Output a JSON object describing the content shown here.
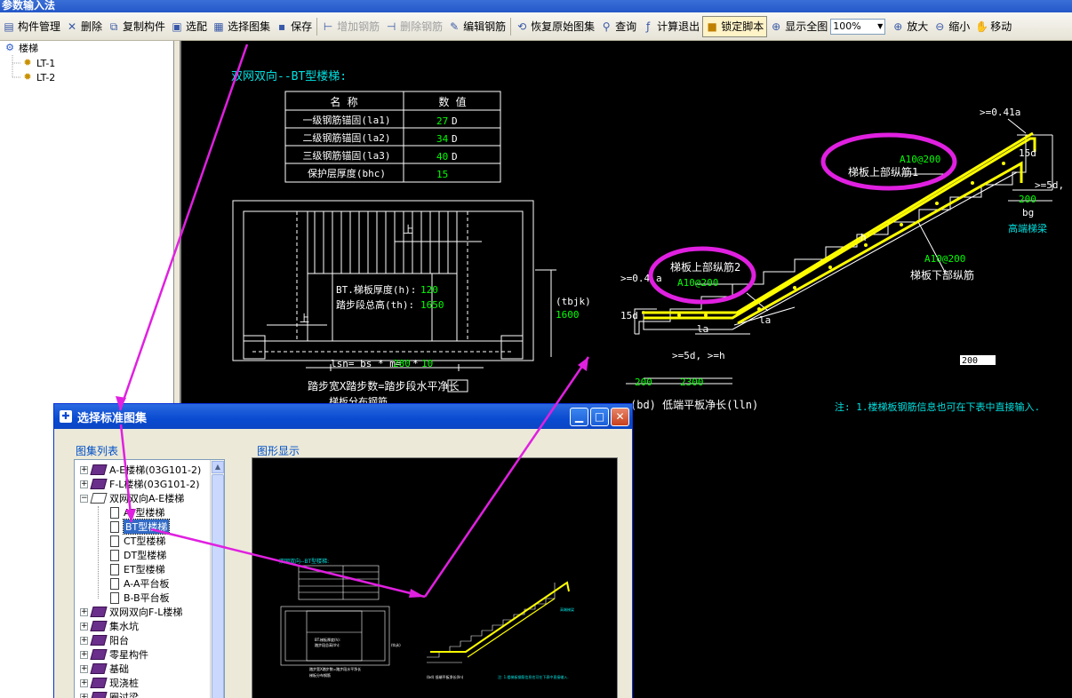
{
  "app": {
    "title": "参数输入法"
  },
  "toolbar": {
    "items": [
      {
        "label": "构件管理",
        "icon": "component-manage-icon",
        "glyph": "▤"
      },
      {
        "label": "删除",
        "icon": "delete-icon",
        "glyph": "✕"
      },
      {
        "label": "复制构件",
        "icon": "copy-icon",
        "glyph": "⧉"
      },
      {
        "label": "选配",
        "icon": "select-match-icon",
        "glyph": "▣"
      },
      {
        "label": "选择图集",
        "icon": "atlas-icon",
        "glyph": "▦"
      },
      {
        "label": "保存",
        "icon": "save-icon",
        "glyph": "▪"
      },
      {
        "label": "增加钢筋",
        "icon": "add-rebar-icon",
        "glyph": "⊢"
      },
      {
        "label": "删除钢筋",
        "icon": "delete-rebar-icon",
        "glyph": "⊣"
      },
      {
        "label": "编辑钢筋",
        "icon": "edit-rebar-icon",
        "glyph": "✎"
      },
      {
        "label": "恢复原始图集",
        "icon": "restore-icon",
        "glyph": "⟲"
      },
      {
        "label": "查询",
        "icon": "binoculars-icon",
        "glyph": "⚲"
      },
      {
        "label": "计算退出",
        "icon": "calc-exit-icon",
        "glyph": "ƒ"
      },
      {
        "label": "锁定脚本",
        "icon": "lock-icon",
        "glyph": "🔒"
      },
      {
        "label": "显示全图",
        "icon": "fit-view-icon",
        "glyph": "⊕"
      },
      {
        "label": "放大",
        "icon": "zoom-in-icon",
        "glyph": "⊕"
      },
      {
        "label": "缩小",
        "icon": "zoom-out-icon",
        "glyph": "⊖"
      },
      {
        "label": "移动",
        "icon": "hand-icon",
        "glyph": "✋"
      }
    ],
    "zoom_value": "100%"
  },
  "tree": {
    "root": "楼梯",
    "items": [
      "LT-1",
      "LT-2"
    ]
  },
  "cad": {
    "heading": "双网双向--BT型楼梯:",
    "table": {
      "headers": [
        "名  称",
        "数  值"
      ],
      "rows": [
        {
          "name": "一级钢筋锚固(la1)",
          "value": "27",
          "unit": "D"
        },
        {
          "name": "二级钢筋锚固(la2)",
          "value": "34",
          "unit": "D"
        },
        {
          "name": "三级钢筋锚固(la3)",
          "value": "40",
          "unit": "D"
        },
        {
          "name": "保护层厚度(bhc)",
          "value": "15",
          "unit": ""
        }
      ]
    },
    "plan": {
      "up_label": "上",
      "thickness_label": "BT.梯板厚度(h):",
      "thickness_value": "120",
      "height_label": "踏步段总高(th):",
      "height_value": "1650",
      "lsn_label": "lsn= bs * m=",
      "lsn_bs": "280",
      "lsn_m": "10",
      "formula": "踏步宽X踏步数=踏步段水平净长",
      "tbjk": "(tbjk)",
      "tbjk_value": "1600",
      "cut_text": "梯板分布钢筋"
    },
    "section": {
      "upper_rebar1_label": "梯板上部纵筋1",
      "upper_rebar1_spec": "A10@200",
      "upper_rebar2_label": "梯板上部纵筋2",
      "upper_rebar2_spec": "A10@200",
      "lower_rebar_label": "梯板下部纵筋",
      "lower_rebar_spec": "A10@200",
      "top_dim": ">=0.41a",
      "left_dim": ">=0.4",
      "left_dim_suffix": "a",
      "fifteen_d": "15d",
      "fifteen_d_top": "15d",
      "five_d_top": ">=5d,",
      "five_d_bottom": ">=5d, >=h",
      "h_label": "h",
      "la1": "la",
      "la2": "la",
      "w200_top": "200",
      "bg": "bg",
      "high_beam": "高端梯梁",
      "w200_bottom": "200",
      "w2300": "2300",
      "bottom_caption": "(bd) 低端平板净长(lln)",
      "input_value": "200",
      "note": "注: 1.楼梯板钢筋信息也可在下表中直接输入."
    }
  },
  "dialog": {
    "title": "选择标准图集",
    "list_label": "图集列表",
    "preview_label": "图形显示",
    "tree": [
      {
        "label": "A-E楼梯(03G101-2)",
        "level": 0,
        "kind": "book",
        "expanded": false
      },
      {
        "label": "F-L楼梯(03G101-2)",
        "level": 0,
        "kind": "book",
        "expanded": false
      },
      {
        "label": "双网双向A-E楼梯",
        "level": 0,
        "kind": "book",
        "expanded": true
      },
      {
        "label": "AT型楼梯",
        "level": 1,
        "kind": "doc"
      },
      {
        "label": "BT型楼梯",
        "level": 1,
        "kind": "doc",
        "selected": true
      },
      {
        "label": "CT型楼梯",
        "level": 1,
        "kind": "doc"
      },
      {
        "label": "DT型楼梯",
        "level": 1,
        "kind": "doc"
      },
      {
        "label": "ET型楼梯",
        "level": 1,
        "kind": "doc"
      },
      {
        "label": "A-A平台板",
        "level": 1,
        "kind": "doc"
      },
      {
        "label": "B-B平台板",
        "level": 1,
        "kind": "doc"
      },
      {
        "label": "双网双向F-L楼梯",
        "level": 0,
        "kind": "book",
        "expanded": false
      },
      {
        "label": "集水坑",
        "level": 0,
        "kind": "book",
        "expanded": false
      },
      {
        "label": "阳台",
        "level": 0,
        "kind": "book",
        "expanded": false
      },
      {
        "label": "零星构件",
        "level": 0,
        "kind": "book",
        "expanded": false
      },
      {
        "label": "基础",
        "level": 0,
        "kind": "book",
        "expanded": false
      },
      {
        "label": "现浇桩",
        "level": 0,
        "kind": "book",
        "expanded": false
      },
      {
        "label": "圈过梁",
        "level": 0,
        "kind": "book",
        "expanded": false
      }
    ]
  },
  "colors": {
    "cad_bg": "#000000",
    "cad_white": "#ffffff",
    "cad_cyan": "#00e0e0",
    "cad_green": "#00ff00",
    "cad_yellow": "#ffff00",
    "highlight_magenta": "#e020e0",
    "selection": "#316ac5"
  }
}
